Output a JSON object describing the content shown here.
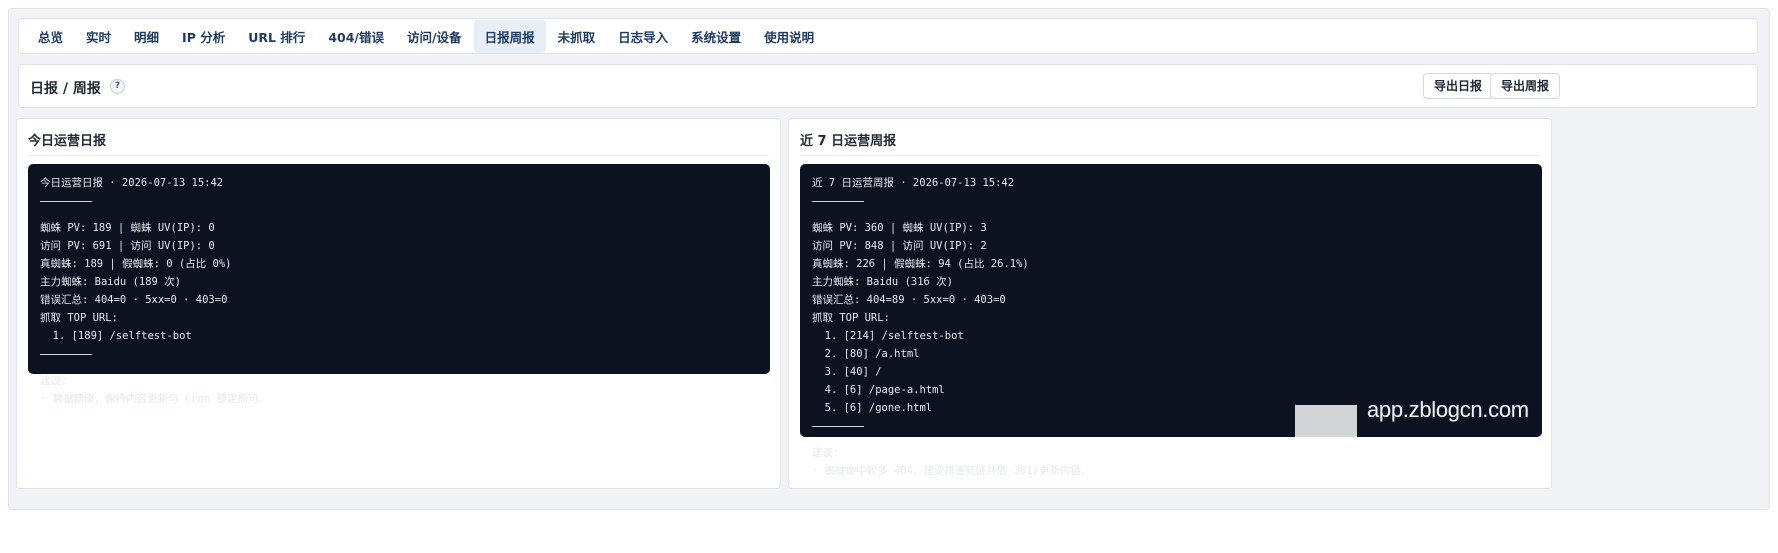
{
  "tabs": [
    {
      "label": "总览"
    },
    {
      "label": "实时"
    },
    {
      "label": "明细"
    },
    {
      "label": "IP 分析"
    },
    {
      "label": "URL 排行"
    },
    {
      "label": "404/错误"
    },
    {
      "label": "访问/设备"
    },
    {
      "label": "日报周报",
      "active": true
    },
    {
      "label": "未抓取"
    },
    {
      "label": "日志导入"
    },
    {
      "label": "系统设置"
    },
    {
      "label": "使用说明"
    }
  ],
  "header": {
    "title": "日报 / 周报",
    "help_label": "?",
    "export_daily_label": "导出日报",
    "export_weekly_label": "导出周报"
  },
  "daily": {
    "panel_title": "今日运营日报",
    "lines": [
      "今日运营日报 · 2026-07-13 15:42",
      "---RULE---",
      "蜘蛛 PV: 189 | 蜘蛛 UV(IP): 0",
      "访问 PV: 691 | 访问 UV(IP): 0",
      "真蜘蛛: 189 | 假蜘蛛: 0 (占比 0%)",
      "主力蜘蛛: Baidu (189 次)",
      "错误汇总: 404=0 · 5xx=0 · 403=0",
      "抓取 TOP URL:",
      "  1. [189] /selftest-bot",
      "---RULE---",
      "建议:",
      "· 数据健康，保持内容更新与 Cron 稳定即可。"
    ]
  },
  "weekly": {
    "panel_title": "近 7 日运营周报",
    "lines": [
      "近 7 日运营周报 · 2026-07-13 15:42",
      "---RULE---",
      "蜘蛛 PV: 360 | 蜘蛛 UV(IP): 3",
      "访问 PV: 848 | 访问 UV(IP): 2",
      "真蜘蛛: 226 | 假蜘蛛: 94 (占比 26.1%)",
      "主力蜘蛛: Baidu (316 次)",
      "错误汇总: 404=89 · 5xx=0 · 403=0",
      "抓取 TOP URL:",
      "  1. [214] /selftest-bot",
      "  2. [80] /a.html",
      "  3. [40] /",
      "  4. [6] /page-a.html",
      "  5. [6] /gone.html",
      "---RULE---",
      "建议:",
      "· 蜘蛛命中较多 404，建议排查死链并做 301/更新内链。"
    ]
  },
  "watermark": {
    "text": "app.zblogcn.com"
  }
}
